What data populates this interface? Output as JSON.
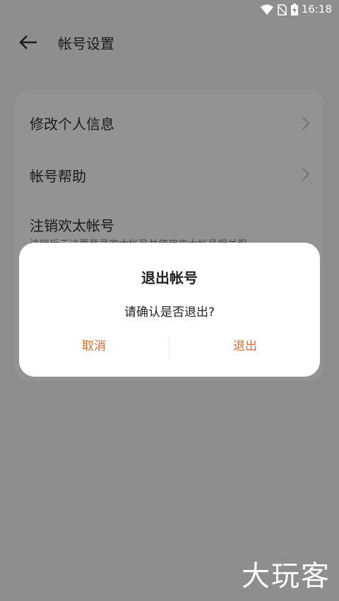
{
  "statusbar": {
    "time": "16:18"
  },
  "header": {
    "title": "帐号设置"
  },
  "menu": {
    "items": [
      {
        "label": "修改个人信息"
      },
      {
        "label": "帐号帮助"
      },
      {
        "label": "注销欢太帐号",
        "sub": "注销后无法再登录欢太帐号并使用欢太帐号相关服"
      }
    ]
  },
  "dialog": {
    "title": "退出帐号",
    "message": "请确认是否退出?",
    "cancel_label": "取消",
    "confirm_label": "退出",
    "accent_color": "#e0692c"
  },
  "watermark": {
    "text": "大玩客"
  }
}
